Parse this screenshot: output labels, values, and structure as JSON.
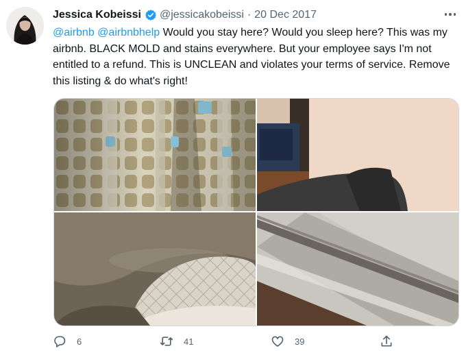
{
  "tweet": {
    "author": {
      "name": "Jessica Kobeissi",
      "handle": "@jessicakobeissi",
      "verified": true,
      "avatar_icon": "profile-photo"
    },
    "separator": "·",
    "date": "20 Dec 2017",
    "mentions": [
      "@airbnb",
      "@airbnbhelp"
    ],
    "body": "Would you stay here? Would you sleep here? This was my airbnb. BLACK MOLD and stains everywhere. But your employee says I'm not entitled to a refund. This is UNCLEAN and violates your terms of service. Remove this listing & do what's right!",
    "photos": [
      {
        "icon": "moldy-shower-curtain-photo"
      },
      {
        "icon": "room-corner-with-armchair-photo"
      },
      {
        "icon": "stained-bedding-photo"
      },
      {
        "icon": "mattress-edge-photo"
      }
    ],
    "actions": {
      "reply": {
        "icon": "reply-icon",
        "count": "6"
      },
      "retweet": {
        "icon": "retweet-icon",
        "count": "41"
      },
      "like": {
        "icon": "like-icon",
        "count": "39"
      },
      "share": {
        "icon": "share-icon"
      }
    }
  },
  "colors": {
    "link": "#1d9bf0",
    "secondary_text": "#536471",
    "primary_text": "#0f1419",
    "border": "#cfd9de"
  }
}
